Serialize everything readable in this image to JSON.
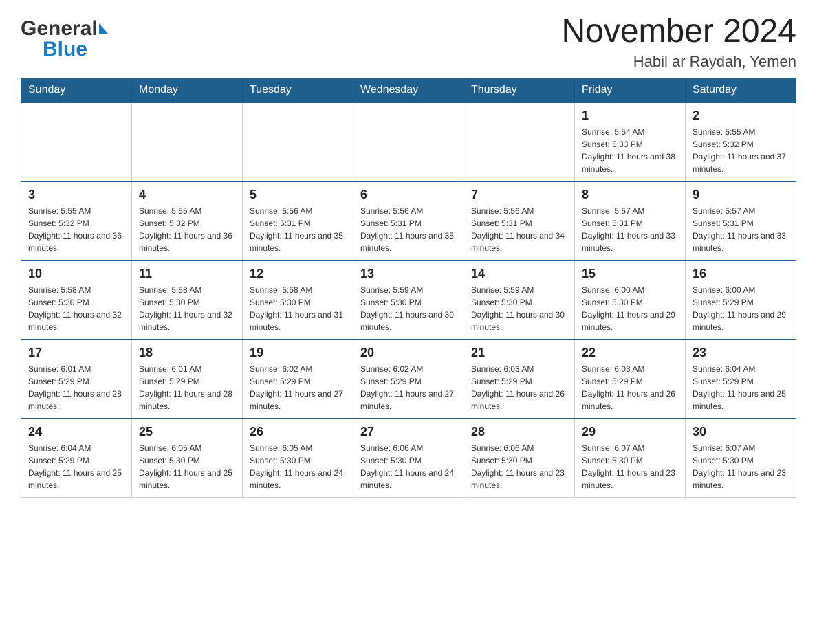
{
  "logo": {
    "general": "General",
    "blue": "Blue"
  },
  "title": "November 2024",
  "subtitle": "Habil ar Raydah, Yemen",
  "headers": [
    "Sunday",
    "Monday",
    "Tuesday",
    "Wednesday",
    "Thursday",
    "Friday",
    "Saturday"
  ],
  "weeks": [
    [
      {
        "day": "",
        "sunrise": "",
        "sunset": "",
        "daylight": ""
      },
      {
        "day": "",
        "sunrise": "",
        "sunset": "",
        "daylight": ""
      },
      {
        "day": "",
        "sunrise": "",
        "sunset": "",
        "daylight": ""
      },
      {
        "day": "",
        "sunrise": "",
        "sunset": "",
        "daylight": ""
      },
      {
        "day": "",
        "sunrise": "",
        "sunset": "",
        "daylight": ""
      },
      {
        "day": "1",
        "sunrise": "Sunrise: 5:54 AM",
        "sunset": "Sunset: 5:33 PM",
        "daylight": "Daylight: 11 hours and 38 minutes."
      },
      {
        "day": "2",
        "sunrise": "Sunrise: 5:55 AM",
        "sunset": "Sunset: 5:32 PM",
        "daylight": "Daylight: 11 hours and 37 minutes."
      }
    ],
    [
      {
        "day": "3",
        "sunrise": "Sunrise: 5:55 AM",
        "sunset": "Sunset: 5:32 PM",
        "daylight": "Daylight: 11 hours and 36 minutes."
      },
      {
        "day": "4",
        "sunrise": "Sunrise: 5:55 AM",
        "sunset": "Sunset: 5:32 PM",
        "daylight": "Daylight: 11 hours and 36 minutes."
      },
      {
        "day": "5",
        "sunrise": "Sunrise: 5:56 AM",
        "sunset": "Sunset: 5:31 PM",
        "daylight": "Daylight: 11 hours and 35 minutes."
      },
      {
        "day": "6",
        "sunrise": "Sunrise: 5:56 AM",
        "sunset": "Sunset: 5:31 PM",
        "daylight": "Daylight: 11 hours and 35 minutes."
      },
      {
        "day": "7",
        "sunrise": "Sunrise: 5:56 AM",
        "sunset": "Sunset: 5:31 PM",
        "daylight": "Daylight: 11 hours and 34 minutes."
      },
      {
        "day": "8",
        "sunrise": "Sunrise: 5:57 AM",
        "sunset": "Sunset: 5:31 PM",
        "daylight": "Daylight: 11 hours and 33 minutes."
      },
      {
        "day": "9",
        "sunrise": "Sunrise: 5:57 AM",
        "sunset": "Sunset: 5:31 PM",
        "daylight": "Daylight: 11 hours and 33 minutes."
      }
    ],
    [
      {
        "day": "10",
        "sunrise": "Sunrise: 5:58 AM",
        "sunset": "Sunset: 5:30 PM",
        "daylight": "Daylight: 11 hours and 32 minutes."
      },
      {
        "day": "11",
        "sunrise": "Sunrise: 5:58 AM",
        "sunset": "Sunset: 5:30 PM",
        "daylight": "Daylight: 11 hours and 32 minutes."
      },
      {
        "day": "12",
        "sunrise": "Sunrise: 5:58 AM",
        "sunset": "Sunset: 5:30 PM",
        "daylight": "Daylight: 11 hours and 31 minutes."
      },
      {
        "day": "13",
        "sunrise": "Sunrise: 5:59 AM",
        "sunset": "Sunset: 5:30 PM",
        "daylight": "Daylight: 11 hours and 30 minutes."
      },
      {
        "day": "14",
        "sunrise": "Sunrise: 5:59 AM",
        "sunset": "Sunset: 5:30 PM",
        "daylight": "Daylight: 11 hours and 30 minutes."
      },
      {
        "day": "15",
        "sunrise": "Sunrise: 6:00 AM",
        "sunset": "Sunset: 5:30 PM",
        "daylight": "Daylight: 11 hours and 29 minutes."
      },
      {
        "day": "16",
        "sunrise": "Sunrise: 6:00 AM",
        "sunset": "Sunset: 5:29 PM",
        "daylight": "Daylight: 11 hours and 29 minutes."
      }
    ],
    [
      {
        "day": "17",
        "sunrise": "Sunrise: 6:01 AM",
        "sunset": "Sunset: 5:29 PM",
        "daylight": "Daylight: 11 hours and 28 minutes."
      },
      {
        "day": "18",
        "sunrise": "Sunrise: 6:01 AM",
        "sunset": "Sunset: 5:29 PM",
        "daylight": "Daylight: 11 hours and 28 minutes."
      },
      {
        "day": "19",
        "sunrise": "Sunrise: 6:02 AM",
        "sunset": "Sunset: 5:29 PM",
        "daylight": "Daylight: 11 hours and 27 minutes."
      },
      {
        "day": "20",
        "sunrise": "Sunrise: 6:02 AM",
        "sunset": "Sunset: 5:29 PM",
        "daylight": "Daylight: 11 hours and 27 minutes."
      },
      {
        "day": "21",
        "sunrise": "Sunrise: 6:03 AM",
        "sunset": "Sunset: 5:29 PM",
        "daylight": "Daylight: 11 hours and 26 minutes."
      },
      {
        "day": "22",
        "sunrise": "Sunrise: 6:03 AM",
        "sunset": "Sunset: 5:29 PM",
        "daylight": "Daylight: 11 hours and 26 minutes."
      },
      {
        "day": "23",
        "sunrise": "Sunrise: 6:04 AM",
        "sunset": "Sunset: 5:29 PM",
        "daylight": "Daylight: 11 hours and 25 minutes."
      }
    ],
    [
      {
        "day": "24",
        "sunrise": "Sunrise: 6:04 AM",
        "sunset": "Sunset: 5:29 PM",
        "daylight": "Daylight: 11 hours and 25 minutes."
      },
      {
        "day": "25",
        "sunrise": "Sunrise: 6:05 AM",
        "sunset": "Sunset: 5:30 PM",
        "daylight": "Daylight: 11 hours and 25 minutes."
      },
      {
        "day": "26",
        "sunrise": "Sunrise: 6:05 AM",
        "sunset": "Sunset: 5:30 PM",
        "daylight": "Daylight: 11 hours and 24 minutes."
      },
      {
        "day": "27",
        "sunrise": "Sunrise: 6:06 AM",
        "sunset": "Sunset: 5:30 PM",
        "daylight": "Daylight: 11 hours and 24 minutes."
      },
      {
        "day": "28",
        "sunrise": "Sunrise: 6:06 AM",
        "sunset": "Sunset: 5:30 PM",
        "daylight": "Daylight: 11 hours and 23 minutes."
      },
      {
        "day": "29",
        "sunrise": "Sunrise: 6:07 AM",
        "sunset": "Sunset: 5:30 PM",
        "daylight": "Daylight: 11 hours and 23 minutes."
      },
      {
        "day": "30",
        "sunrise": "Sunrise: 6:07 AM",
        "sunset": "Sunset: 5:30 PM",
        "daylight": "Daylight: 11 hours and 23 minutes."
      }
    ]
  ]
}
